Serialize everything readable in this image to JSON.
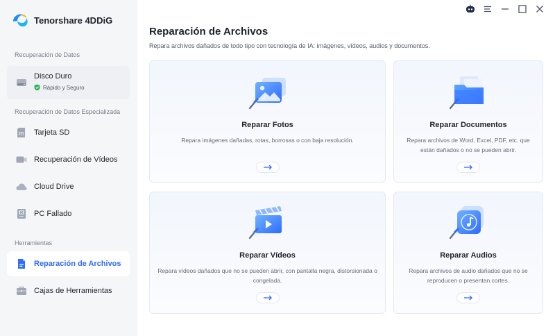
{
  "app": {
    "name": "Tenorshare 4DDiG"
  },
  "sidebar": {
    "sections": [
      {
        "label": "Recuperación de Datos"
      },
      {
        "label": "Recuperación de Datos Especializada"
      },
      {
        "label": "Herramientas"
      }
    ],
    "disk": {
      "label": "Disco Duro",
      "status": "Rápido y Seguro"
    },
    "items": [
      {
        "label": "Tarjeta SD",
        "icon": "sd-card-icon"
      },
      {
        "label": "Recuperación de Vídeos",
        "icon": "video-camera-icon"
      },
      {
        "label": "Cloud Drive",
        "icon": "cloud-icon"
      },
      {
        "label": "PC Fallado",
        "icon": "crashed-pc-icon"
      },
      {
        "label": "Reparación de Archivos",
        "icon": "file-repair-icon",
        "active": true
      },
      {
        "label": "Cajas de Herramientas",
        "icon": "toolbox-icon"
      }
    ]
  },
  "window_controls": [
    "assistant-robot-icon",
    "menu-icon",
    "minimize-icon",
    "maximize-icon",
    "close-icon"
  ],
  "main": {
    "title": "Reparación de Archivos",
    "subtitle": "Repara archivos dañados de todo tipo con tecnología de IA: imágenes, vídeos, audios y documentos.",
    "cards": [
      {
        "title": "Reparar Fotos",
        "description": "Repara imágenes dañadas, rotas, borrosas o con baja resolución.",
        "icon": "photo-repair-icon"
      },
      {
        "title": "Reparar Documentos",
        "description": "Repara archivos de Word, Excel, PDF, etc. que están dañados o no se pueden abrir.",
        "icon": "document-repair-icon"
      },
      {
        "title": "Reparar Vídeos",
        "description": "Repara vídeos dañados que no se pueden abrir, con pantalla negra, distorsionada o congelada.",
        "icon": "video-repair-icon"
      },
      {
        "title": "Reparar Audios",
        "description": "Repara archivos de audio dañados que no se reproducen o presentan cortes.",
        "icon": "audio-repair-icon"
      }
    ]
  },
  "colors": {
    "accent": "#2f6bff",
    "sidebar_bg": "#f5f6f8",
    "secure_green": "#2db55d"
  }
}
